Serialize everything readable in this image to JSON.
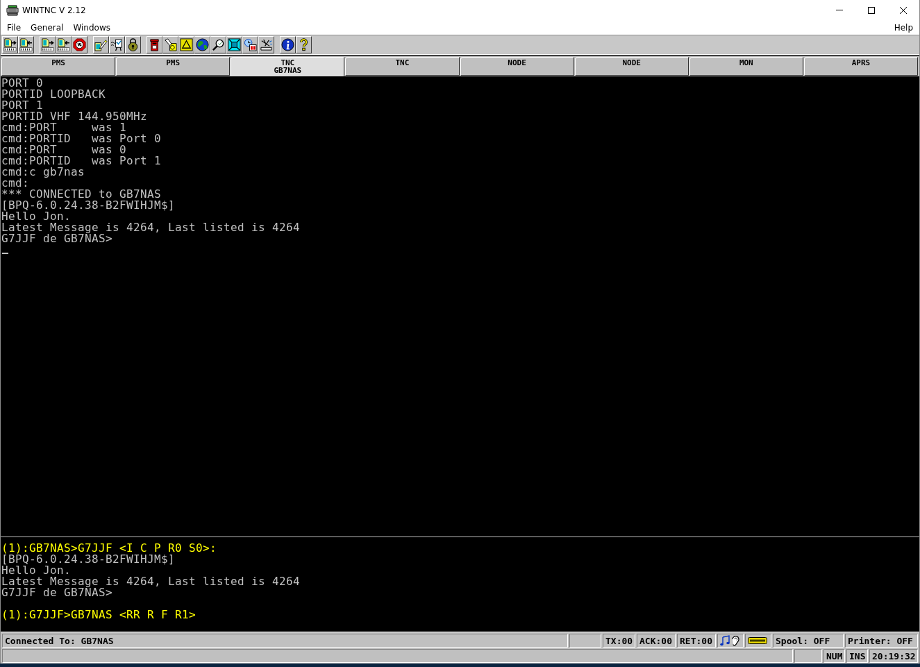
{
  "window": {
    "title": "WINTNC V 2.12"
  },
  "menu": {
    "left": [
      {
        "label": "File"
      },
      {
        "label": "General"
      },
      {
        "label": "Windows"
      }
    ],
    "right": [
      {
        "label": "Help"
      }
    ]
  },
  "tabs": [
    {
      "label": "PMS",
      "selected": false
    },
    {
      "label": "PMS",
      "selected": false
    },
    {
      "label": "TNC",
      "sublabel": "GB7NAS",
      "selected": true
    },
    {
      "label": "TNC",
      "selected": false
    },
    {
      "label": "NODE",
      "selected": false
    },
    {
      "label": "NODE",
      "selected": false
    },
    {
      "label": "MON",
      "selected": false
    },
    {
      "label": "APRS",
      "selected": false
    }
  ],
  "upper_pane": {
    "lines": [
      "PORT 0",
      "PORTID LOOPBACK",
      "PORT 1",
      "PORTID VHF 144.950MHz",
      "cmd:PORT     was 1",
      "cmd:PORTID   was Port 0",
      "cmd:PORT     was 0",
      "cmd:PORTID   was Port 1",
      "cmd:c gb7nas",
      "cmd:",
      "*** CONNECTED to GB7NAS",
      "[BPQ-6.0.24.38-B2FWIHJM$]",
      "Hello Jon.",
      "Latest Message is 4264, Last listed is 4264",
      "G7JJF de GB7NAS>"
    ],
    "cursor": true
  },
  "lower_pane": {
    "lines": [
      {
        "kind": "prompt",
        "text": "(1):GB7NAS>G7JJF <I C P R0 S0>:"
      },
      {
        "kind": "output",
        "text": "[BPQ-6.0.24.38-B2FWIHJM$]"
      },
      {
        "kind": "output",
        "text": "Hello Jon."
      },
      {
        "kind": "output",
        "text": "Latest Message is 4264, Last listed is 4264"
      },
      {
        "kind": "output",
        "text": "G7JJF de GB7NAS>"
      },
      {
        "kind": "blank"
      },
      {
        "kind": "prompt",
        "text": "(1):G7JJF>GB7NAS <RR R F R1>"
      }
    ]
  },
  "status_bar": {
    "connection": "Connected To: GB7NAS",
    "counters": [
      "TX:00",
      "ACK:00",
      "RET:00"
    ],
    "spool": "Spool: OFF",
    "printer": "Printer: OFF",
    "keys": [
      "NUM",
      "INS"
    ],
    "clock": "20:19:32"
  }
}
